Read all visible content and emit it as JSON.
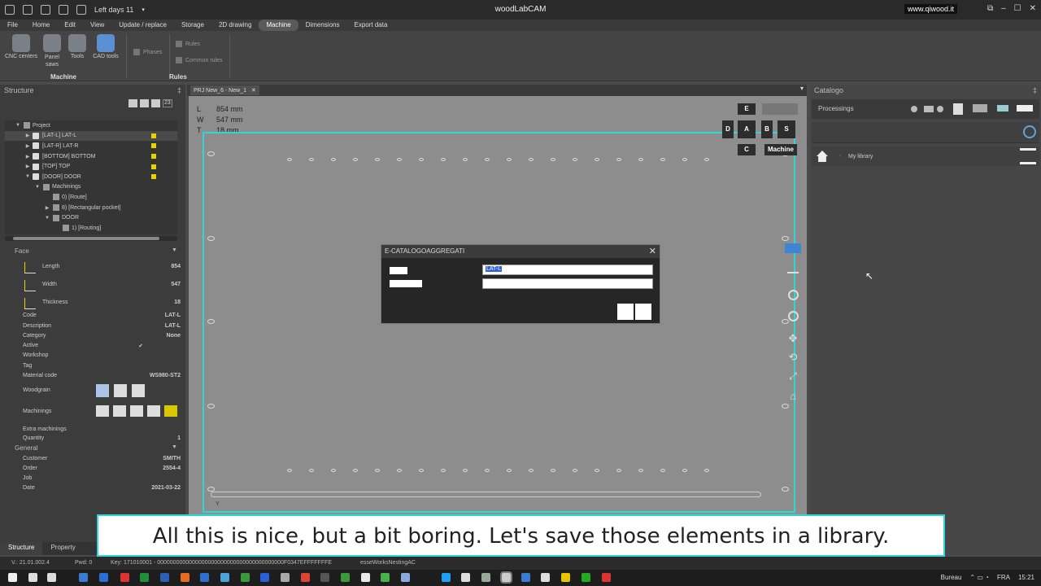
{
  "titlebar": {
    "app_title": "woodLabCAM",
    "days_left": "Left days 11",
    "url": "www.qiwood.it",
    "win_controls": [
      "⧉",
      "–",
      "☐",
      "✕"
    ]
  },
  "menu": [
    "File",
    "Home",
    "Edit",
    "View",
    "Update / replace",
    "Storage",
    "2D drawing",
    "Machine",
    "Dimensions",
    "Export data"
  ],
  "menu_active": "Machine",
  "ribbon": {
    "buttons": [
      {
        "label": "CNC centers",
        "icon": "gear-icon"
      },
      {
        "label": "Panel saws",
        "icon": "gear-icon"
      },
      {
        "label": "Tools",
        "icon": "tools-icon"
      },
      {
        "label": "CAD tools",
        "icon": "cad-icon"
      }
    ],
    "phases_label": "Phases",
    "rules_label": "Rules",
    "common_rules_label": "Common rules",
    "group_machine": "Machine",
    "group_rules": "Rules"
  },
  "structure": {
    "title": "Structure",
    "pin": "‡",
    "counter": "23",
    "tree": [
      {
        "indent": 0,
        "twisty": "▼",
        "label": "Project",
        "checkbox": false
      },
      {
        "indent": 1,
        "twisty": "▶",
        "label": "[LAT-L] LAT-L",
        "checkbox": true,
        "flag": true
      },
      {
        "indent": 1,
        "twisty": "▶",
        "label": "[LAT-R] LAT-R",
        "checkbox": true,
        "flag": true
      },
      {
        "indent": 1,
        "twisty": "▶",
        "label": "[BOTTOM] BOTTOM",
        "checkbox": true,
        "flag": true
      },
      {
        "indent": 1,
        "twisty": "▶",
        "label": "[TOP] TOP",
        "checkbox": true,
        "flag": true
      },
      {
        "indent": 1,
        "twisty": "▼",
        "label": "[DOOR] DOOR",
        "checkbox": true,
        "flag": true
      },
      {
        "indent": 2,
        "twisty": "▼",
        "label": "Machinings",
        "checkbox": false
      },
      {
        "indent": 3,
        "twisty": "",
        "label": "0) [Route]",
        "checkbox": false
      },
      {
        "indent": 3,
        "twisty": "▶",
        "label": "8) [Rectangular pocket]",
        "checkbox": false
      },
      {
        "indent": 3,
        "twisty": "▼",
        "label": "DOOR",
        "checkbox": false
      },
      {
        "indent": 4,
        "twisty": "",
        "label": "1) [Routing]",
        "checkbox": false
      }
    ]
  },
  "face": {
    "title": "Face",
    "rows": [
      {
        "label": "Length",
        "value": "854"
      },
      {
        "label": "Width",
        "value": "547"
      },
      {
        "label": "Thickness",
        "value": "18"
      },
      {
        "label": "Code",
        "value": "LAT-L"
      },
      {
        "label": "Description",
        "value": "LAT-L"
      },
      {
        "label": "Category",
        "value": "None"
      },
      {
        "label": "Active",
        "value": "✔"
      },
      {
        "label": "Workshop",
        "value": ""
      },
      {
        "label": "Tag",
        "value": ""
      },
      {
        "label": "Material code",
        "value": "WS980-ST2"
      },
      {
        "label": "Woodgrain",
        "value": ""
      },
      {
        "label": "Machinings",
        "value": ""
      },
      {
        "label": "Extra machinings",
        "value": ""
      },
      {
        "label": "Quantity",
        "value": "1"
      }
    ],
    "general_title": "General",
    "general_rows": [
      {
        "label": "Customer",
        "value": "SMITH"
      },
      {
        "label": "Order",
        "value": "2554-4"
      },
      {
        "label": "Job",
        "value": ""
      },
      {
        "label": "Date",
        "value": "2021-03-22"
      }
    ]
  },
  "left_tabs": [
    "Structure",
    "Property"
  ],
  "document": {
    "tab_label": "PRJ New_6 - New_1",
    "dims": [
      {
        "k": "L",
        "v": "854 mm"
      },
      {
        "k": "W",
        "v": "547 mm"
      },
      {
        "k": "T",
        "v": "18 mm"
      }
    ],
    "face_buttons": [
      "E",
      "D",
      "A",
      "B",
      "S",
      "C",
      "Machine"
    ],
    "axis_label": "Y"
  },
  "dialog": {
    "title": "E-CATALOGOAGGREGATI",
    "close": "✕",
    "field1_value": "LAT-L"
  },
  "catalog": {
    "title": "Catalogo",
    "tab": "Processings",
    "path": "My library"
  },
  "subtitle": "All this is nice, but a bit boring. Let's save those elements in a library.",
  "status": {
    "version": "V.: 21.01.002.4",
    "pwd": "Pwd: 0",
    "key": "Key: 171010001 - 0000000000000000000000000000000000000000F0347EFFFFFFFE",
    "module": "esseWorksNestingAC"
  },
  "taskbar": {
    "bureau": "Bureau",
    "lang": "FRA",
    "time": "15:21"
  }
}
